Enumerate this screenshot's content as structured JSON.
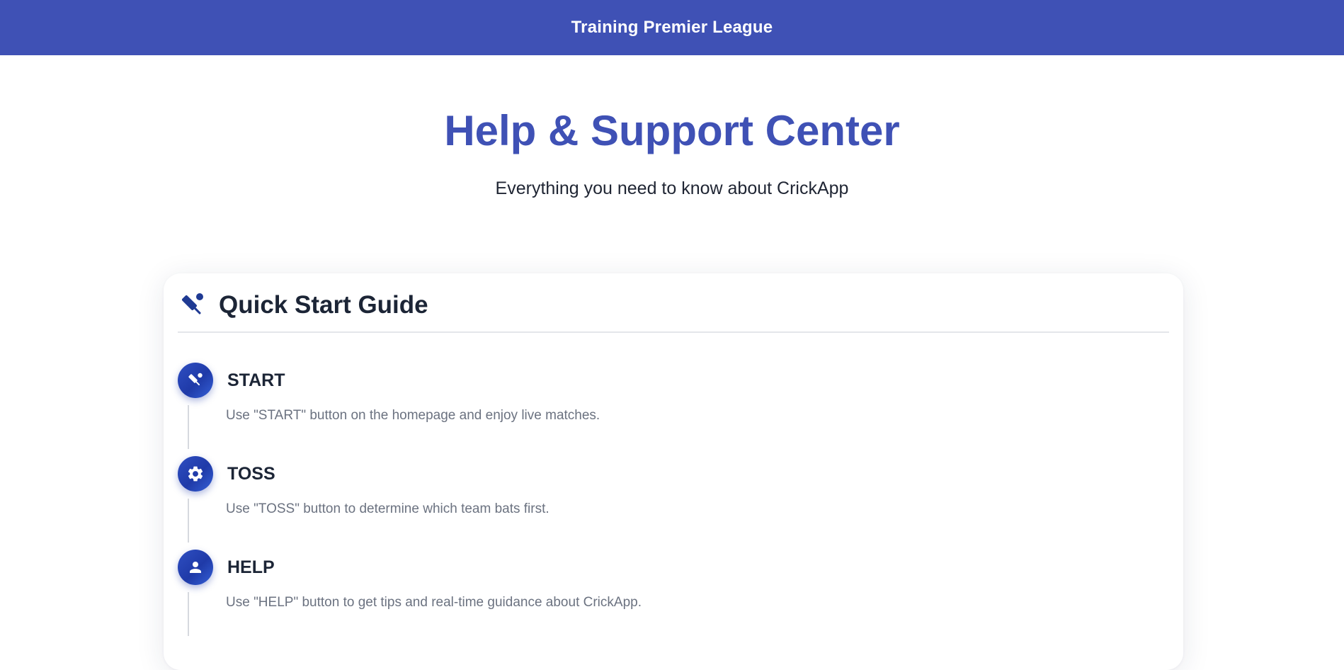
{
  "header": {
    "title": "Training Premier League",
    "background": "#3f51b5"
  },
  "hero": {
    "title": "Help & Support Center",
    "subtitle": "Everything you need to know about CrickApp",
    "title_color": "#3f51b5"
  },
  "quick_start": {
    "title": "Quick Start Guide",
    "icon": "cricket-icon",
    "steps": [
      {
        "icon": "cricket-icon",
        "title": "START",
        "description": "Use \"START\" button on the homepage and enjoy live matches."
      },
      {
        "icon": "gear-icon",
        "title": "TOSS",
        "description": "Use \"TOSS\" button to determine which team bats first."
      },
      {
        "icon": "person-icon",
        "title": "HELP",
        "description": "Use \"HELP\" button to get tips and real-time guidance about CrickApp."
      }
    ]
  },
  "colors": {
    "accent": "#3f51b5",
    "badge": "#2f4fc2",
    "heading": "#1c2536",
    "muted": "#6b7280"
  }
}
